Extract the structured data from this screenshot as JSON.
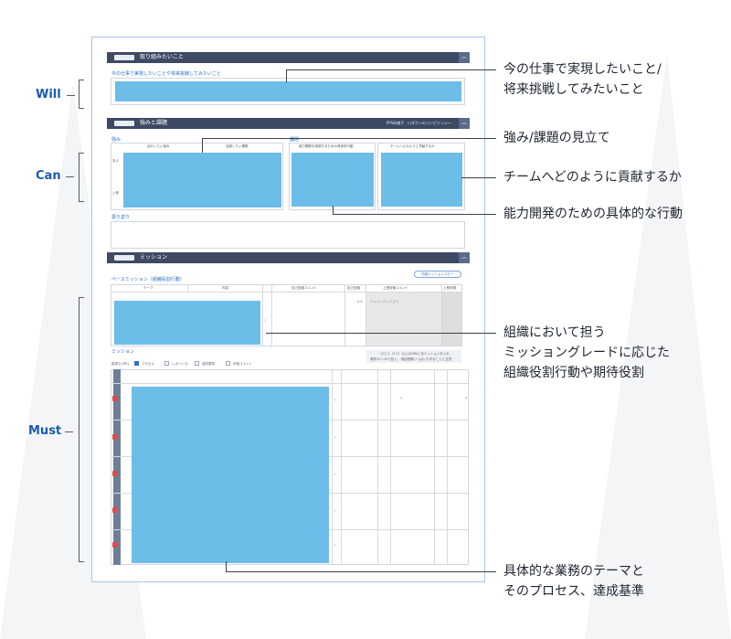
{
  "annotations": {
    "will": [
      "今の仕事で実現したいこと/",
      "将来挑戦してみたいこと"
    ],
    "strength": "強み/課題の見立て",
    "contribute": "チームへどのように貢献するか",
    "action": "能力開発のための具体的な行動",
    "org": [
      "組織において担う",
      "ミッショングレードに応じた",
      "組織役割行動や期待役割"
    ],
    "theme": [
      "具体的な業務のテーマと",
      "そのプロセス、達成基準"
    ]
  },
  "categories": {
    "will": "Will",
    "can": "Can",
    "must": "Must"
  },
  "sections": {
    "will": {
      "title": "取り組みたいこと",
      "label": "今の仕事で実現したいことや将来挑戦してみたいこと"
    },
    "can": {
      "title": "強みと課題",
      "link1": "PPS的様子",
      "link2": "ロダホンのコンピテンシー",
      "strength_label": "強み",
      "issue_label": "課題",
      "col1": "活かしたい強み",
      "col2": "克服したい課題",
      "col3": "能力開発を実現するための具体的行動",
      "col4": "チームへどのように貢献するか",
      "row1": "本人",
      "row2": "上長",
      "reflect_label": "振り返り"
    },
    "mission": {
      "title": "ミッション",
      "button": "所属ミッションコピー",
      "base_label": "ベースミッション（組織役割行動）",
      "col_theme": "テーマ",
      "col_content": "内容",
      "col_self_comment": "自己評価コメント",
      "col_self": "自己評価",
      "col_boss_comment": "上長評価コメント",
      "col_boss": "上長評価",
      "score": "2.5",
      "placeholder": "テキストが入ります。",
      "mission_label": "ミッション",
      "note1": "・ひとつ（1つ）以上のHPAに全ミッションを入れ",
      "note2": "原則10～15で記入。項目間隔いっぱいも作ることに注意",
      "filter_label": "縦表示(3件)",
      "check1": "プロセス",
      "check2": "レポート元",
      "check3": "達成基準",
      "check4": "評価コメント"
    }
  }
}
